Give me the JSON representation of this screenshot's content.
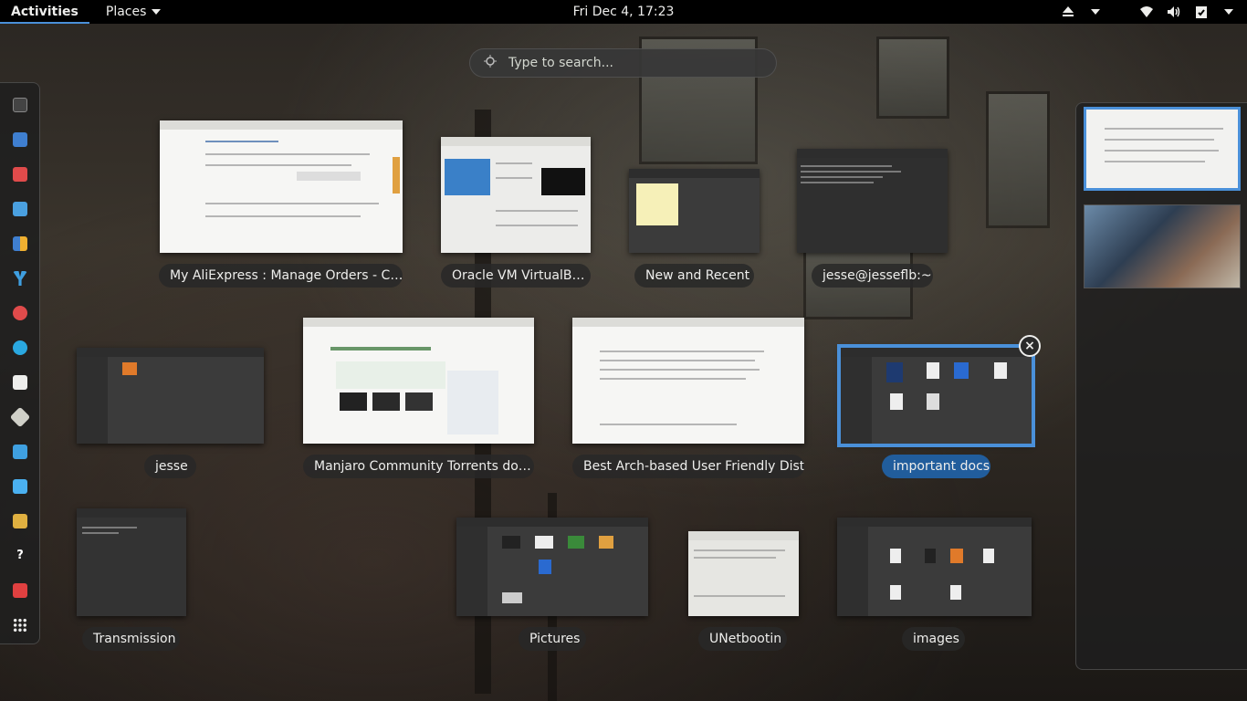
{
  "topbar": {
    "activities": "Activities",
    "places": "Places",
    "clock": "Fri Dec  4, 17:23"
  },
  "tray_icons": [
    "eject-icon",
    "chevron-down-icon",
    "wifi-icon",
    "volume-icon",
    "clipboard-check-icon",
    "chevron-down-icon"
  ],
  "search": {
    "placeholder": "Type to search..."
  },
  "dash_apps": [
    "terminal",
    "finder",
    "music",
    "text-editor",
    "calculator",
    "yakuake",
    "chromium",
    "skype",
    "book-reader",
    "inkscape",
    "image-viewer",
    "document-viewer",
    "files",
    "help",
    "software",
    "app-grid"
  ],
  "windows": [
    {
      "title": "My AliExpress : Manage Orders - C…"
    },
    {
      "title": "Oracle VM VirtualB…"
    },
    {
      "title": "New and Recent"
    },
    {
      "title": "jesse@jesseflb:~"
    },
    {
      "title": "jesse"
    },
    {
      "title": "Manjaro Community Torrents do…"
    },
    {
      "title": "Best Arch-based User Friendly Dist…"
    },
    {
      "title": "important docs"
    },
    {
      "title": "Transmission"
    },
    {
      "title": "Pictures"
    },
    {
      "title": "UNetbootin"
    },
    {
      "title": "images"
    }
  ],
  "workspace_count": 2,
  "colors": {
    "accent": "#4a90d9",
    "selected_caption": "#215d9c",
    "topbar": "#000000"
  }
}
